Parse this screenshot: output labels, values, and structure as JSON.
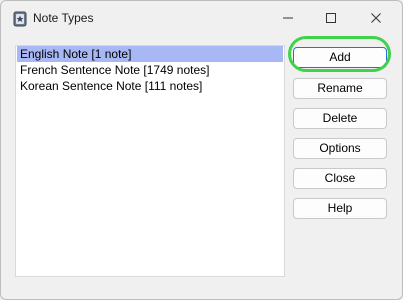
{
  "window": {
    "title": "Note Types"
  },
  "note_types": [
    {
      "label": "English Note [1 note]",
      "selected": true
    },
    {
      "label": "French Sentence Note [1749 notes]",
      "selected": false
    },
    {
      "label": "Korean Sentence Note [111 notes]",
      "selected": false
    }
  ],
  "buttons": {
    "add": "Add",
    "rename": "Rename",
    "delete": "Delete",
    "options": "Options",
    "close": "Close",
    "help": "Help"
  },
  "colors": {
    "selection": "#a8b8f5",
    "highlight_ring": "#3fd24a",
    "default_button_border": "#2d6bd6"
  },
  "icons": {
    "app": "anki-app-icon",
    "minimize": "minimize-icon",
    "maximize": "maximize-icon",
    "close": "close-icon"
  }
}
